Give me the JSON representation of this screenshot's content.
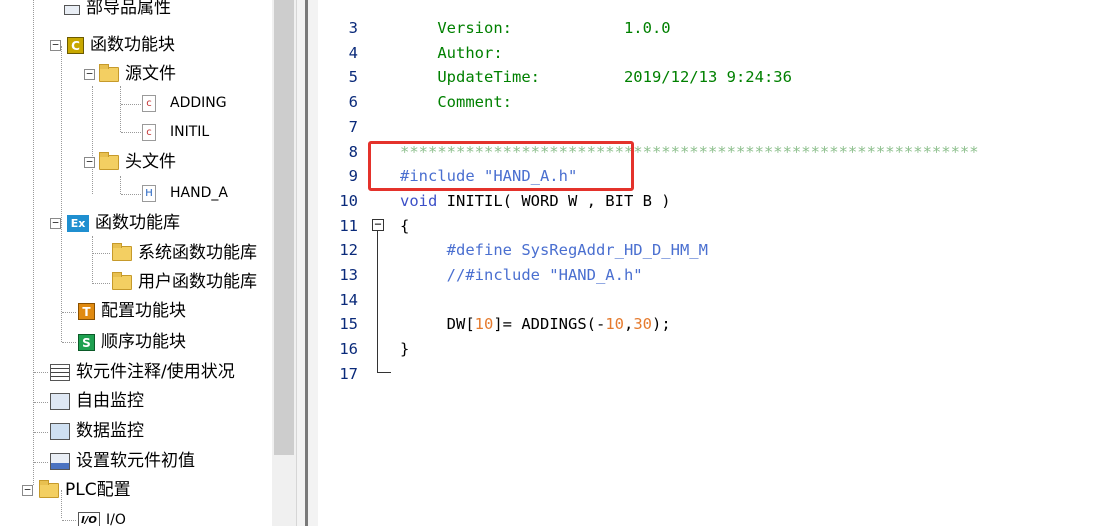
{
  "tree": {
    "items": [
      {
        "label": "部导品属性"
      },
      {
        "label": "函数功能块",
        "icon_text": "C"
      },
      {
        "label": "源文件"
      },
      {
        "label": "ADDING",
        "icon_text": "c"
      },
      {
        "label": "INITIL",
        "icon_text": "c"
      },
      {
        "label": "头文件"
      },
      {
        "label": "HAND_A",
        "icon_text": "H"
      },
      {
        "label": "函数功能库",
        "icon_text": "Ex"
      },
      {
        "label": "系统函数功能库"
      },
      {
        "label": "用户函数功能库"
      },
      {
        "label": "配置功能块",
        "icon_text": "T"
      },
      {
        "label": "顺序功能块",
        "icon_text": "S"
      },
      {
        "label": "软元件注释/使用状况"
      },
      {
        "label": "自由监控"
      },
      {
        "label": "数据监控"
      },
      {
        "label": "设置软元件初值"
      },
      {
        "label": "PLC配置"
      },
      {
        "label": "I/O",
        "icon_text": "I/O"
      }
    ],
    "expander_minus": "−"
  },
  "editor": {
    "lines": [
      {
        "num": "3",
        "parts": [
          {
            "t": "    Version:            1.0.0",
            "c": "c-comment"
          }
        ]
      },
      {
        "num": "4",
        "parts": [
          {
            "t": "    Author:",
            "c": "c-comment"
          }
        ]
      },
      {
        "num": "5",
        "parts": [
          {
            "t": "    UpdateTime:         2019/12/13 9:24:36",
            "c": "c-comment"
          }
        ]
      },
      {
        "num": "6",
        "parts": [
          {
            "t": "    Comment:",
            "c": "c-comment"
          }
        ]
      },
      {
        "num": "7",
        "parts": []
      },
      {
        "num": "8",
        "parts": [
          {
            "t": "**************************************************************",
            "c": "c-star"
          }
        ]
      },
      {
        "num": "9",
        "parts": [
          {
            "t": "#include \"HAND_A.h\"",
            "c": "c-pre"
          }
        ]
      },
      {
        "num": "10",
        "parts": [
          {
            "t": "void ",
            "c": "c-kw"
          },
          {
            "t": "INITIL( WORD W , BIT B )",
            "c": "c-id"
          }
        ]
      },
      {
        "num": "11",
        "parts": [
          {
            "t": "{",
            "c": "c-id"
          }
        ]
      },
      {
        "num": "12",
        "parts": [
          {
            "t": "     #define SysRegAddr_HD_D_HM_M",
            "c": "c-pre"
          }
        ]
      },
      {
        "num": "13",
        "parts": [
          {
            "t": "     //#include \"HAND_A.h\"",
            "c": "c-pre"
          }
        ]
      },
      {
        "num": "14",
        "parts": []
      },
      {
        "num": "15",
        "parts": [
          {
            "t": "     DW[",
            "c": "c-id"
          },
          {
            "t": "10",
            "c": "c-num"
          },
          {
            "t": "]= ADDINGS(-",
            "c": "c-id"
          },
          {
            "t": "10",
            "c": "c-num"
          },
          {
            "t": ",",
            "c": "c-id"
          },
          {
            "t": "30",
            "c": "c-num"
          },
          {
            "t": ");",
            "c": "c-id"
          }
        ]
      },
      {
        "num": "16",
        "parts": [
          {
            "t": "}",
            "c": "c-id"
          }
        ]
      },
      {
        "num": "17",
        "parts": []
      }
    ],
    "fold_symbol": "−",
    "highlight_color": "#e4322b"
  }
}
